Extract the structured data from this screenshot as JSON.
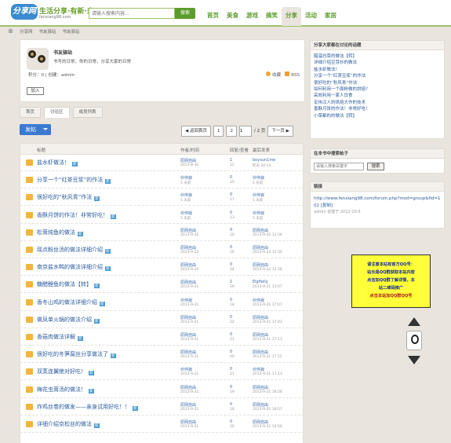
{
  "header": {
    "logo_badge": "分享网",
    "logo_text": "生活分享·有新·来",
    "logo_url": "fenxiang98.com",
    "search_placeholder": "请输入搜索内容...",
    "search_button": "搜索",
    "nav": [
      "首页",
      "美食",
      "游戏",
      "搞笑",
      "分享",
      "活动",
      "家居"
    ],
    "nav_active": 4
  },
  "breadcrumb": [
    "分享网",
    "书友驿站",
    "书友驿站"
  ],
  "group": {
    "title": "书友驿站",
    "desc": "书写的日常，你的日常，分享大家的日常",
    "meta": "积分：0 | 创建：admin",
    "fav": "收藏",
    "rss": "RSS",
    "join": "加入"
  },
  "tabs": [
    "首页",
    "讨论区",
    "成员列表"
  ],
  "tab_active": 1,
  "post_button": "发帖",
  "pager": {
    "prev": "◀ 返回首页",
    "pages": [
      "1",
      "2"
    ],
    "input": "1",
    "total": "/ 2 页",
    "next": "下一页 ▶"
  },
  "list_header": {
    "title": "标题",
    "author": "作者/时间",
    "counts": "回复/查看",
    "last": "最后发表"
  },
  "rows": [
    {
      "title": "盐水虾做法！",
      "badge": "新",
      "author": "原网自由",
      "date": "2013-8-30",
      "c1": "1",
      "c2": "22",
      "last": "boysun1me",
      "ldate": "昨天 20:13"
    },
    {
      "title": "分享一个“红茶豆浆”的作法",
      "badge": "新",
      "author": "伙伴寂",
      "date": "5 天前",
      "c1": "0",
      "c2": "15",
      "last": "伙伴寂",
      "ldate": "5 天前"
    },
    {
      "title": "很好吃的“秋风青”作法",
      "badge": "新",
      "author": "伙伴寂",
      "date": "5 天前",
      "c1": "0",
      "c2": "17",
      "last": "伙伴寂",
      "ldate": "5 天前"
    },
    {
      "title": "香酥月饼的作法！非常好吃！",
      "badge": "新",
      "author": "伙伴寂",
      "date": "5 天前",
      "c1": "0",
      "c2": "13",
      "last": "伙伴寂",
      "ldate": "5 天前"
    },
    {
      "title": "松茸炖鱼的做法",
      "badge": "新",
      "author": "原网自由",
      "date": "2013-9-22",
      "c1": "0",
      "c2": "20",
      "last": "原网自由",
      "ldate": "2013-9-22 12:34"
    },
    {
      "title": "瑶点粉丝汤的做法详细介绍",
      "badge": "新",
      "author": "原网自由",
      "date": "2013-9-22",
      "c1": "0",
      "c2": "26",
      "last": "原网自由",
      "ldate": "2013-9-22 12:30"
    },
    {
      "title": "南京盐水鸭的做法详细介绍",
      "badge": "新",
      "author": "原网自由",
      "date": "2013-9-22",
      "c1": "0",
      "c2": "24",
      "last": "原网自由",
      "ldate": "2013-9-22 12:26"
    },
    {
      "title": "糖醋鲤鱼的做法【转】",
      "badge": "新",
      "author": "原网自由",
      "date": "2013-9-21",
      "c1": "1",
      "c2": "29",
      "last": "Elgfielly",
      "ldate": "2013-9-21 13:07"
    },
    {
      "title": "香冬山鸡的做法详细介绍",
      "badge": "新",
      "author": "伙伴寂",
      "date": "2013-9-21",
      "c1": "0",
      "c2": "18",
      "last": "伙伴寂",
      "ldate": "2013-9-21 17:07"
    },
    {
      "title": "做凤单火锅的做法介绍",
      "badge": "新",
      "author": "原网自由",
      "date": "2013-9-21",
      "c1": "0",
      "c2": "22",
      "last": "原网自由",
      "ldate": "2013-9-21 17:43"
    },
    {
      "title": "香菇肉做法详解",
      "badge": "新",
      "author": "原网自由",
      "date": "2013-9-21",
      "c1": "0",
      "c2": "21",
      "last": "原网自由",
      "ldate": "2013-9-21 17:13"
    },
    {
      "title": "很好吃的冬笋腐丝分享做法了",
      "badge": "新",
      "author": "原网自由",
      "date": "2013-9-21",
      "c1": "0",
      "c2": "40",
      "last": "原网自由",
      "ldate": "2013-9-21 17:15"
    },
    {
      "title": "双蒸连翼绝对好吃！",
      "badge": "新",
      "author": "伙伴寂",
      "date": "2013-9-21",
      "c1": "0",
      "c2": "21",
      "last": "伙伴寂",
      "ldate": "2013-9-21 17:13"
    },
    {
      "title": "梅花虫茸汤的做法！",
      "badge": "新",
      "author": "原网自由",
      "date": "2013-9-21",
      "c1": "0",
      "c2": "19",
      "last": "原网自由",
      "ldate": "2013-9-21 16:58"
    },
    {
      "title": "炸鸡丝卷的做发——亲身试用好吃！！",
      "badge": "新",
      "author": "原网自由",
      "date": "2013-9-21",
      "c1": "0",
      "c2": "18",
      "last": "原网自由",
      "ldate": "2013-9-21 16:57"
    },
    {
      "title": "详细介绍京松丝的做法",
      "badge": "新",
      "author": "原网自由",
      "date": "2013-9-21",
      "c1": "0",
      "c2": "20",
      "last": "原网自由",
      "ldate": "2013-9-21 16:56"
    }
  ],
  "side": {
    "hot_title": "分享大家都在讨论的话题",
    "hot_items": [
      "醋溜白菜的做法【转】",
      "详细介绍豆芽炒的做法",
      "盐水虾做法！",
      "分享一个“红茶豆浆”的作法",
      "很好吃的“秋风青”作法",
      "如何利用一个面粉做的烘焙？",
      "高效利用一家人饮食",
      "宏伟汉人的烘焙大作的技术",
      "香酥月饼的作法！非常好吃！",
      "小菜都的的做法【转】"
    ],
    "search_title": "在本书中搜索帖子",
    "search_placeholder": "请输入搜索关键字",
    "search_button": "搜索",
    "link_title": "链接",
    "link_text": "http://www.fenxiang98.com/forum.php?mod=group&fid=102",
    "link_copy": "[复制]",
    "link_meta": "admin 创建于 2012-10-5"
  },
  "ad": {
    "line1": "请注意本站有官方QQ号：",
    "line2": "站长是QQ群获取本站内容",
    "line3": "点击加QQ群了解详情，本",
    "line4": "站二维码推广",
    "line5": "点击本站加QQ群QQ号",
    "colors": {
      "bg": "#ffff3a",
      "text_blue": "#1a2b9a",
      "text_red": "#b02020"
    }
  },
  "colors": {
    "accent": "#5b9c2c",
    "link": "#2a5a9a",
    "button": "#3b7ad1"
  }
}
